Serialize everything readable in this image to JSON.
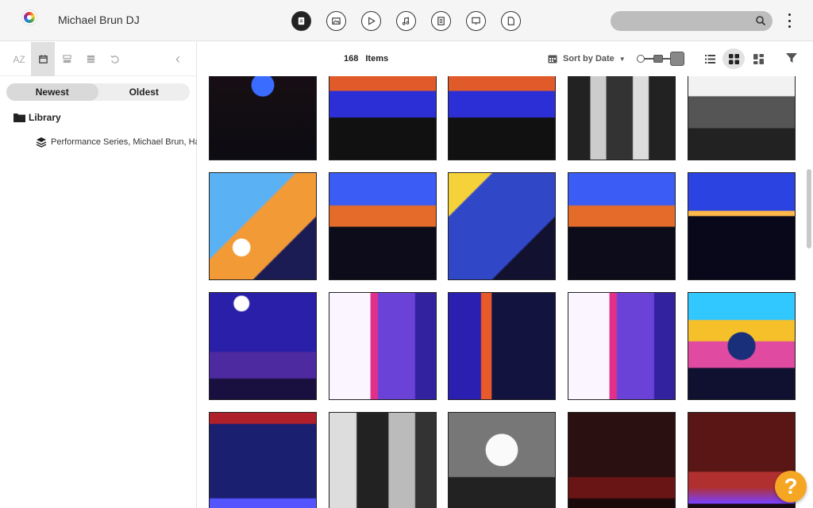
{
  "app": {
    "title": "Michael Brun DJ"
  },
  "header": {
    "type_icons": [
      "all-files-icon",
      "image-icon",
      "video-icon",
      "audio-icon",
      "document-icon",
      "presentation-icon",
      "file-icon"
    ],
    "search": {
      "placeholder": ""
    }
  },
  "sidebar": {
    "tools": [
      "AZ",
      "calendar-icon",
      "layers-icon",
      "stack-icon",
      "undo-icon"
    ],
    "sort": {
      "newest": "Newest",
      "oldest": "Oldest",
      "selected": "Newest"
    },
    "library_label": "Library",
    "collection_label": "Performance Series, Michael Brun, Ha"
  },
  "toolbar": {
    "count": "168",
    "count_label": "Items",
    "sort_label": "Sort by Date",
    "view_selected": "grid"
  },
  "thumbnails": [
    {
      "tone": "stage-dark"
    },
    {
      "tone": "stage-blue"
    },
    {
      "tone": "stage-blue"
    },
    {
      "tone": "bw-crowd"
    },
    {
      "tone": "bw-room"
    },
    {
      "tone": "dj-orange"
    },
    {
      "tone": "silhouette"
    },
    {
      "tone": "dj-blue"
    },
    {
      "tone": "silhouette"
    },
    {
      "tone": "silhouette-dark"
    },
    {
      "tone": "hall-purple"
    },
    {
      "tone": "ih-banner"
    },
    {
      "tone": "stage-side"
    },
    {
      "tone": "ih-banner"
    },
    {
      "tone": "dj-bright"
    },
    {
      "tone": "hall-dark"
    },
    {
      "tone": "bw-banner"
    },
    {
      "tone": "bw-dj"
    },
    {
      "tone": "red-room"
    },
    {
      "tone": "red-stage"
    }
  ],
  "help": {
    "label": "?"
  }
}
